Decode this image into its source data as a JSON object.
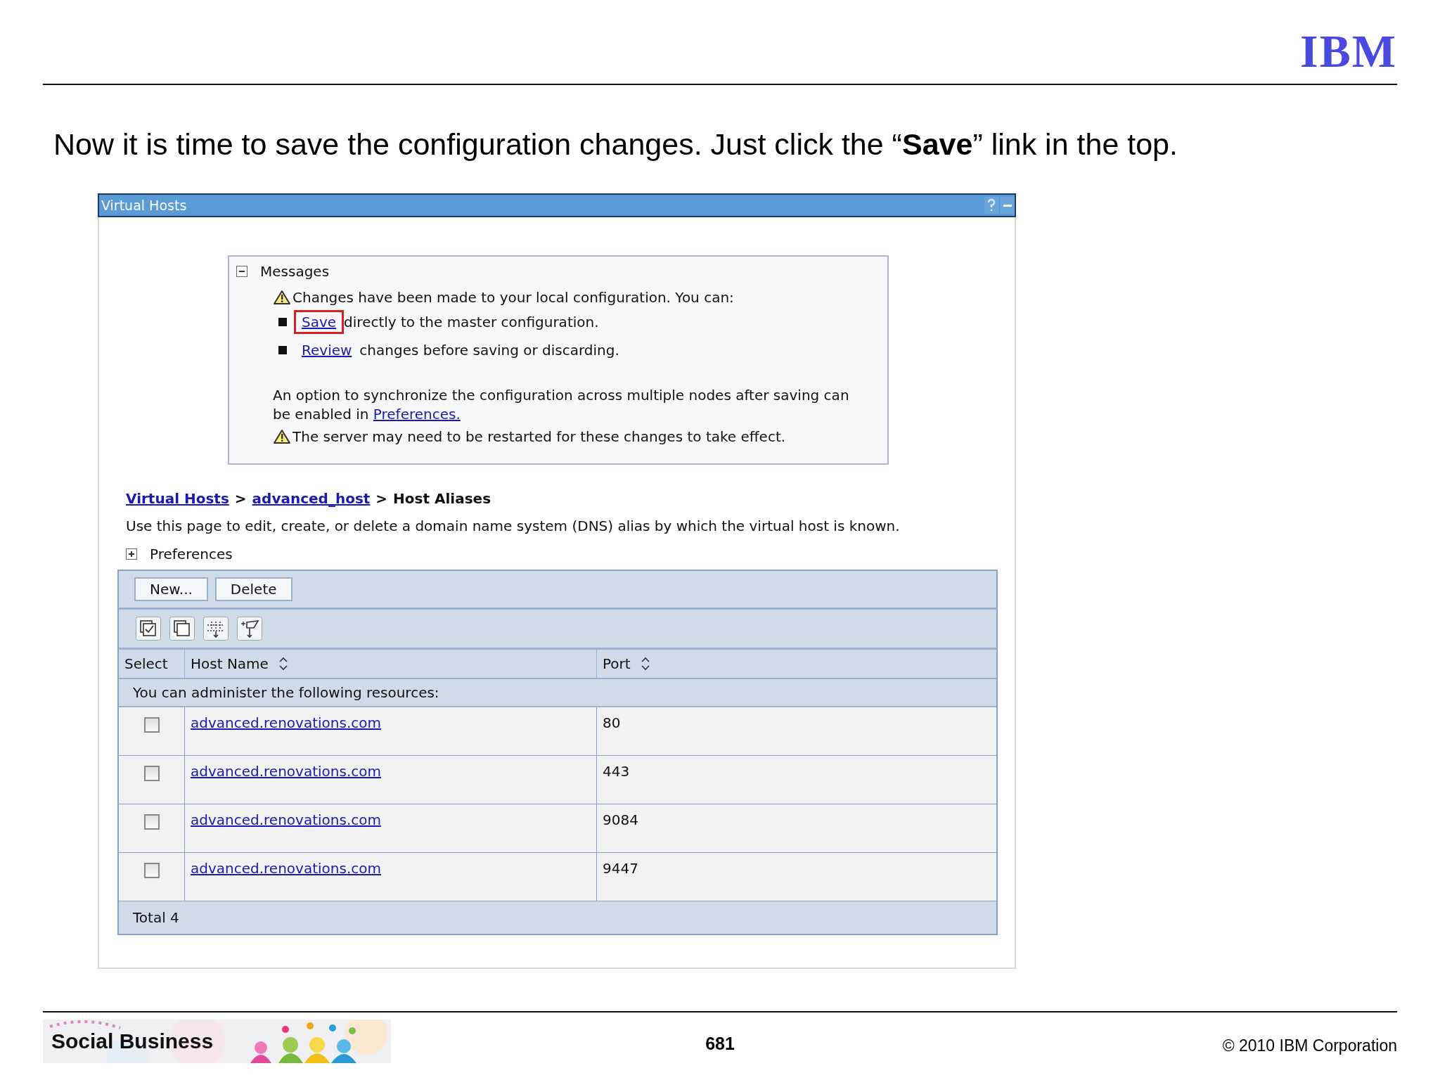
{
  "logo": "IBM",
  "heading": "Now it is time to save the configuration changes. Just click the “**Save**” link in the top.",
  "window": {
    "title": "Virtual Hosts"
  },
  "messages": {
    "title": "Messages",
    "expanded": true,
    "warning": "Changes have been made to your local configuration. You can:",
    "options": [
      {
        "link": "Save",
        "text": "directly to the master configuration.",
        "highlighted": true
      },
      {
        "link": "Review",
        "text": "changes before saving or discarding.",
        "highlighted": false
      }
    ],
    "sync_note": "An option to synchronize the configuration across multiple nodes after saving can be enabled in",
    "sync_link": "Preferences.",
    "restart_warning": "The server may need to be restarted for these changes to take effect."
  },
  "breadcrumb": [
    {
      "label": "Virtual Hosts",
      "kind": "link"
    },
    {
      "label": ">",
      "kind": "separator"
    },
    {
      "label": "advanced_host",
      "kind": "link"
    },
    {
      "label": ">",
      "kind": "separator"
    },
    {
      "label": "Host Aliases",
      "kind": "current"
    }
  ],
  "description": "Use this page to edit, create, or delete a domain name system (DNS) alias by which the virtual host is known.",
  "preferences": {
    "label": "Preferences",
    "expanded": false
  },
  "buttons": [
    "New...",
    "Delete"
  ],
  "table": {
    "columns": [
      {
        "label": "Select",
        "sortable": false
      },
      {
        "label": "Host Name",
        "sortable": true
      },
      {
        "label": "Port",
        "sortable": true
      }
    ],
    "notice": "You can administer the following resources:",
    "rows": [
      {
        "host": "advanced.renovations.com",
        "port": "80",
        "checked": false
      },
      {
        "host": "advanced.renovations.com",
        "port": "443",
        "checked": false
      },
      {
        "host": "advanced.renovations.com",
        "port": "9084",
        "checked": false
      },
      {
        "host": "advanced.renovations.com",
        "port": "9447",
        "checked": false
      }
    ],
    "total": "Total 4"
  },
  "footer": {
    "banner": "Social Business",
    "page": "681",
    "copyright": "© 2010 IBM Corporation"
  }
}
